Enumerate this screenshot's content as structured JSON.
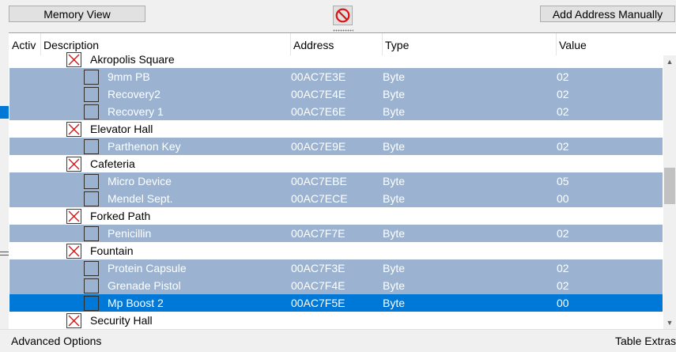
{
  "toolbar": {
    "memory_view_label": "Memory View",
    "add_address_label": "Add Address Manually"
  },
  "columns": {
    "active": "Activ",
    "description": "Description",
    "address": "Address",
    "type": "Type",
    "value": "Value"
  },
  "rows": [
    {
      "kind": "group",
      "description": "Akropolis Square",
      "address": "",
      "type": "",
      "value": ""
    },
    {
      "kind": "item",
      "description": "9mm PB",
      "address": "00AC7E3E",
      "type": "Byte",
      "value": "02"
    },
    {
      "kind": "item",
      "description": "Recovery2",
      "address": "00AC7E4E",
      "type": "Byte",
      "value": "02"
    },
    {
      "kind": "item",
      "description": "Recovery 1",
      "address": "00AC7E6E",
      "type": "Byte",
      "value": "02"
    },
    {
      "kind": "group",
      "description": "Elevator Hall",
      "address": "",
      "type": "",
      "value": ""
    },
    {
      "kind": "item",
      "description": "Parthenon Key",
      "address": "00AC7E9E",
      "type": "Byte",
      "value": "02"
    },
    {
      "kind": "group",
      "description": "Cafeteria",
      "address": "",
      "type": "",
      "value": ""
    },
    {
      "kind": "item",
      "description": "Micro Device",
      "address": "00AC7EBE",
      "type": "Byte",
      "value": "05"
    },
    {
      "kind": "item",
      "description": "Mendel Sept.",
      "address": "00AC7ECE",
      "type": "Byte",
      "value": "00"
    },
    {
      "kind": "group",
      "description": "Forked Path",
      "address": "",
      "type": "",
      "value": ""
    },
    {
      "kind": "item",
      "description": "Penicillin",
      "address": "00AC7F7E",
      "type": "Byte",
      "value": "02"
    },
    {
      "kind": "group",
      "description": "Fountain",
      "address": "",
      "type": "",
      "value": ""
    },
    {
      "kind": "item",
      "description": "Protein Capsule",
      "address": "00AC7F3E",
      "type": "Byte",
      "value": "02"
    },
    {
      "kind": "item",
      "description": "Grenade Pistol",
      "address": "00AC7F4E",
      "type": "Byte",
      "value": "02"
    },
    {
      "kind": "selected",
      "description": "Mp Boost 2",
      "address": "00AC7F5E",
      "type": "Byte",
      "value": "00"
    },
    {
      "kind": "group",
      "description": "Security Hall",
      "address": "",
      "type": "",
      "value": ""
    }
  ],
  "statusbar": {
    "advanced_label": "Advanced Options",
    "extras_label": "Table Extras"
  },
  "colors": {
    "item_row": "#9bb3d0",
    "selected_row": "#0078d7",
    "group_mark": "#c41e1e"
  },
  "icons": [
    "clear-list-icon",
    "group-checkbox-x-icon",
    "checkbox-icon",
    "scroll-up-icon",
    "scroll-down-icon"
  ]
}
